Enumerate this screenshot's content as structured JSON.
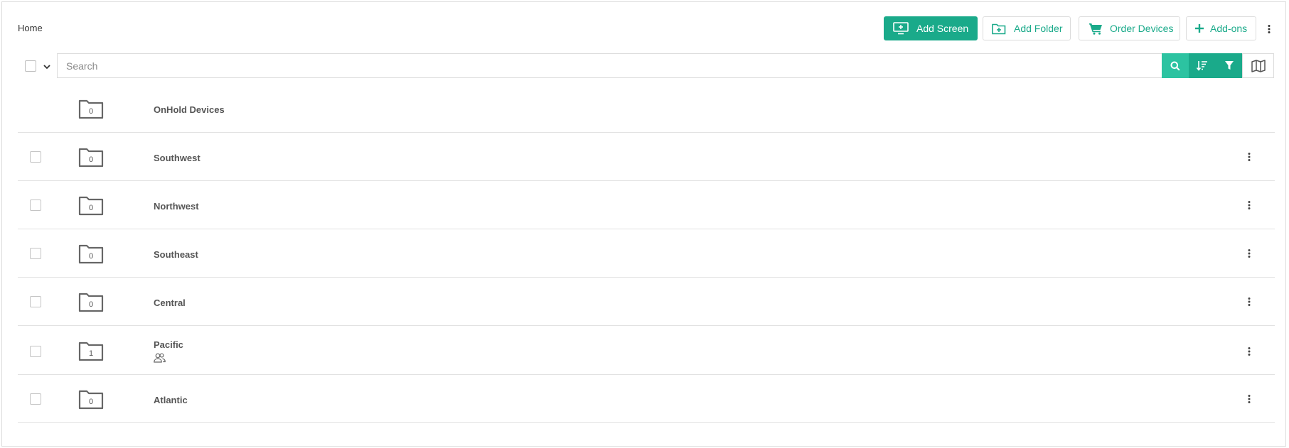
{
  "breadcrumb": "Home",
  "toolbar": {
    "add_screen": "Add Screen",
    "add_folder": "Add Folder",
    "order_devices": "Order Devices",
    "add_ons": "Add-ons"
  },
  "search": {
    "placeholder": "Search",
    "value": ""
  },
  "colors": {
    "accent": "#1aaa8a",
    "accent_light": "#2cc3a1",
    "text": "#555555",
    "border": "#dcdcdc"
  },
  "icons": {
    "add_screen": "monitor-plus-icon",
    "add_folder": "folder-plus-icon",
    "order_devices": "cart-icon",
    "add_ons": "plus-icon",
    "more": "vertical-ellipsis-icon",
    "search": "search-icon",
    "sort": "sort-icon",
    "filter": "filter-icon",
    "map": "map-icon",
    "folder": "folder-icon",
    "shared": "users-icon"
  },
  "folders": [
    {
      "name": "OnHold Devices",
      "count": "0"
    },
    {
      "name": "Southwest",
      "count": "0"
    },
    {
      "name": "Northwest",
      "count": "0"
    },
    {
      "name": "Southeast",
      "count": "0"
    },
    {
      "name": "Central",
      "count": "0"
    },
    {
      "name": "Pacific",
      "count": "1",
      "shared": true
    },
    {
      "name": "Atlantic",
      "count": "0"
    }
  ]
}
